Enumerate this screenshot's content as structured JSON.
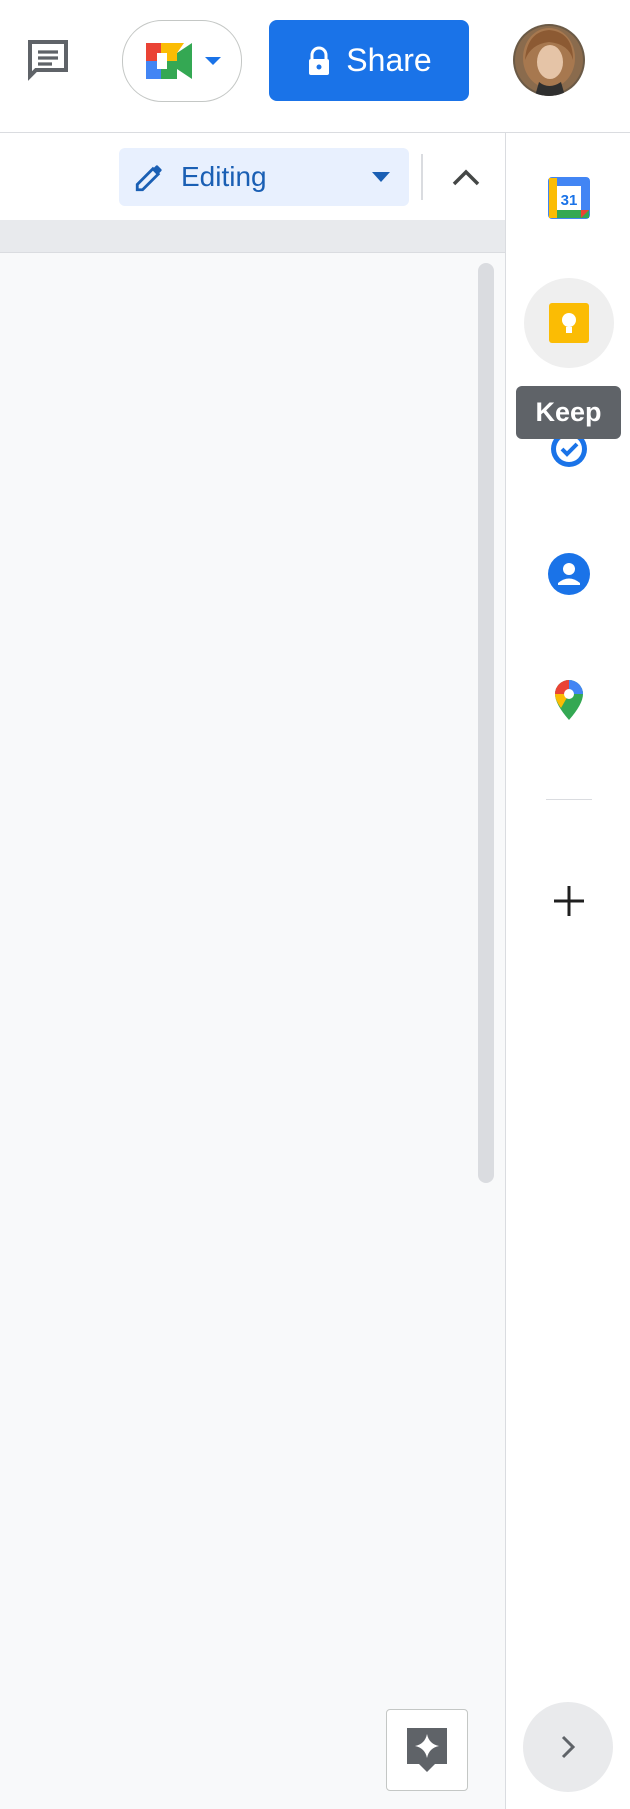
{
  "header": {
    "share_label": "Share",
    "comments_icon": "comment-icon",
    "meet_icon": "google-meet-icon",
    "avatar": "user-avatar"
  },
  "toolbar": {
    "mode_label": "Editing",
    "mode_icon": "pencil-icon",
    "collapse_icon": "chevron-up-icon"
  },
  "side_panel": {
    "apps": [
      {
        "name": "Calendar",
        "icon": "google-calendar-icon",
        "badge": "31"
      },
      {
        "name": "Keep",
        "icon": "google-keep-icon"
      },
      {
        "name": "Tasks",
        "icon": "google-tasks-icon"
      },
      {
        "name": "Contacts",
        "icon": "google-contacts-icon"
      },
      {
        "name": "Maps",
        "icon": "google-maps-icon"
      }
    ],
    "add_icon": "plus-icon",
    "expand_icon": "chevron-right-icon"
  },
  "tooltip": {
    "text": "Keep"
  },
  "colors": {
    "accent": "#1a73e8",
    "editing_bg": "#e8f0fe",
    "editing_text": "#1a5fb4",
    "canvas": "#f8f9fa",
    "tooltip_bg": "#5f6368"
  }
}
